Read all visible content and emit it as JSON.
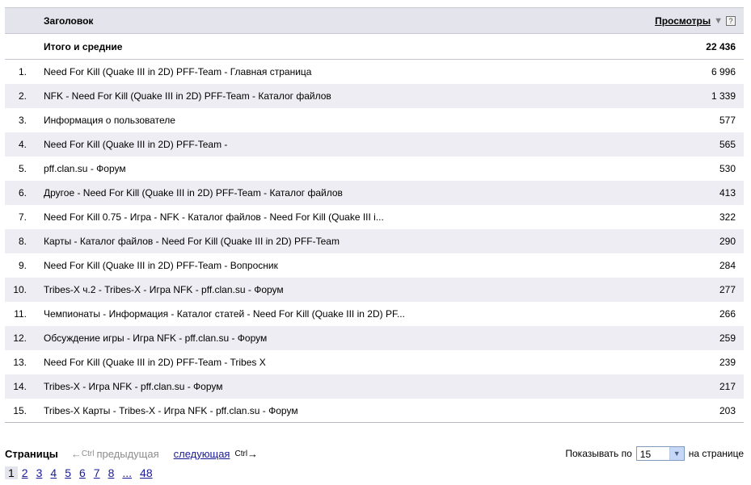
{
  "table": {
    "header": {
      "title_label": "Заголовок",
      "views_label": "Просмотры",
      "sort_arrow": "▼",
      "help_label": "?"
    },
    "total": {
      "label": "Итого и средние",
      "value": "22 436"
    },
    "rows": [
      {
        "num": "1.",
        "title": "Need For Kill (Quake III in 2D) PFF-Team - Главная страница",
        "value": "6 996"
      },
      {
        "num": "2.",
        "title": "NFK - Need For Kill (Quake III in 2D) PFF-Team - Каталог файлов",
        "value": "1 339"
      },
      {
        "num": "3.",
        "title": "Информация о пользователе",
        "value": "577"
      },
      {
        "num": "4.",
        "title": "Need For Kill (Quake III in 2D) PFF-Team -",
        "value": "565"
      },
      {
        "num": "5.",
        "title": "pff.clan.su - Форум",
        "value": "530"
      },
      {
        "num": "6.",
        "title": "Другое - Need For Kill (Quake III in 2D) PFF-Team - Каталог файлов",
        "value": "413"
      },
      {
        "num": "7.",
        "title": "Need For Kill 0.75 - Игра - NFK - Каталог файлов - Need For Kill (Quake III i...",
        "value": "322"
      },
      {
        "num": "8.",
        "title": "Карты - Каталог файлов - Need For Kill (Quake III in 2D) PFF-Team",
        "value": "290"
      },
      {
        "num": "9.",
        "title": "Need For Kill (Quake III in 2D) PFF-Team - Вопросник",
        "value": "284"
      },
      {
        "num": "10.",
        "title": "Tribes-X ч.2 - Tribes-X - Игра NFK - pff.clan.su - Форум",
        "value": "277"
      },
      {
        "num": "11.",
        "title": "Чемпионаты - Информация - Каталог статей - Need For Kill (Quake III in 2D) PF...",
        "value": "266"
      },
      {
        "num": "12.",
        "title": "Обсуждение игры - Игра NFK - pff.clan.su - Форум",
        "value": "259"
      },
      {
        "num": "13.",
        "title": "Need For Kill (Quake III in 2D) PFF-Team - Tribes X",
        "value": "239"
      },
      {
        "num": "14.",
        "title": "Tribes-X - Игра NFK - pff.clan.su - Форум",
        "value": "217"
      },
      {
        "num": "15.",
        "title": "Tribes-X Карты - Tribes-X - Игра NFK - pff.clan.su - Форум",
        "value": "203"
      }
    ]
  },
  "pager": {
    "label": "Страницы",
    "prev_arrow": "←",
    "prev_ctrl": "Ctrl",
    "prev_label": "предыдущая",
    "next_label": "следующая",
    "next_ctrl": "Ctrl",
    "next_arrow": "→",
    "per_page_label": "Показывать по",
    "per_page_value": "15",
    "per_page_suffix": "на странице",
    "pages": [
      "1",
      "2",
      "3",
      "4",
      "5",
      "6",
      "7",
      "8",
      "...",
      "48"
    ],
    "current_page": "1"
  }
}
